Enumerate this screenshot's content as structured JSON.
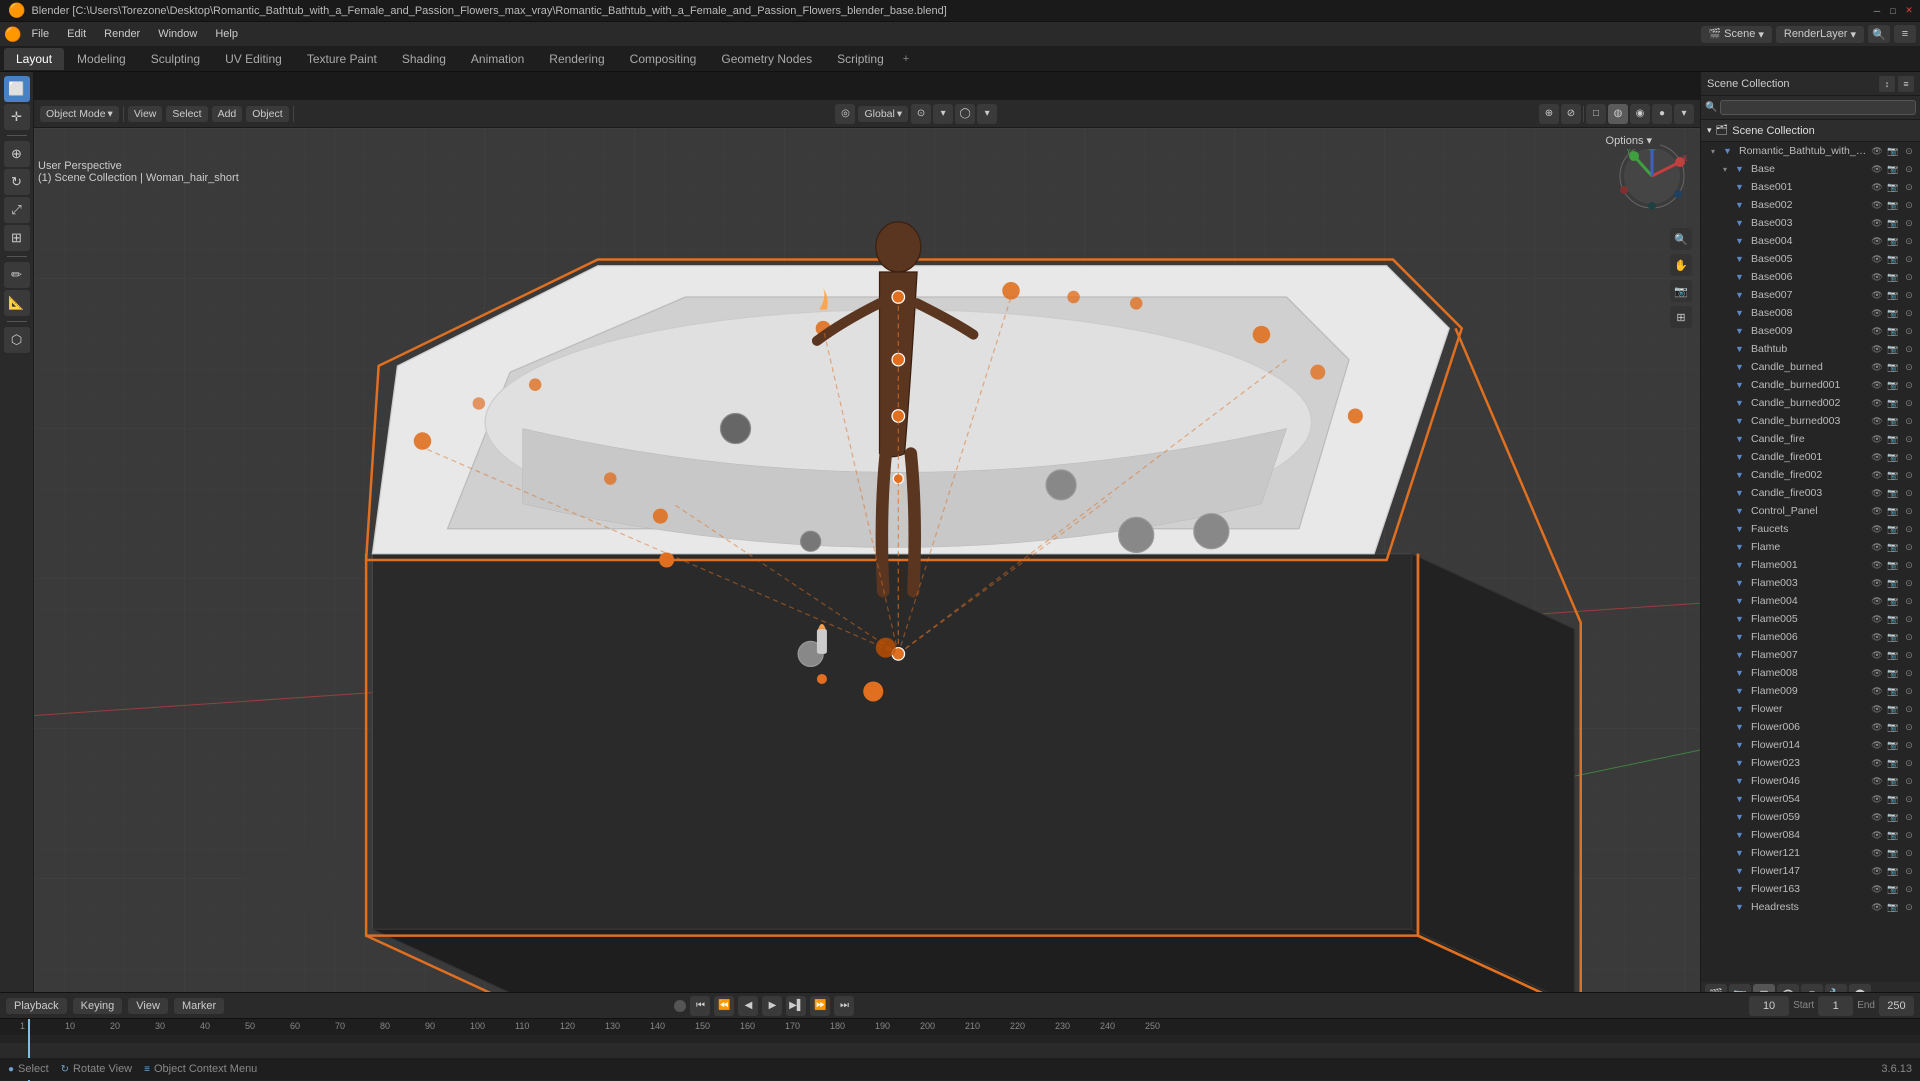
{
  "title": {
    "text": "Blender [C:\\Users\\Torezone\\Desktop\\Romantic_Bathtub_with_a_Female_and_Passion_Flowers_max_vray\\Romantic_Bathtub_with_a_Female_and_Passion_Flowers_blender_base.blend]",
    "window_controls": [
      "minimize",
      "maximize",
      "close"
    ]
  },
  "menu": {
    "items": [
      "Blender",
      "File",
      "Edit",
      "Render",
      "Window",
      "Help"
    ]
  },
  "workspaces": {
    "tabs": [
      "Layout",
      "Modeling",
      "Sculpting",
      "UV Editing",
      "Texture Paint",
      "Shading",
      "Animation",
      "Rendering",
      "Compositing",
      "Geometry Nodes",
      "Scripting"
    ],
    "active": "Layout",
    "add_label": "+"
  },
  "header_toolbar": {
    "mode": "Object Mode",
    "dropdown_arrow": "▾",
    "view_label": "View",
    "select_label": "Select",
    "add_label": "Add",
    "object_label": "Object",
    "transform": "Global",
    "transform_arrow": "▾"
  },
  "viewport": {
    "mode_label": "User Perspective",
    "collection_label": "(1) Scene Collection | Woman_hair_short",
    "options_label": "Options",
    "options_arrow": "▾"
  },
  "left_toolbar": {
    "tools": [
      {
        "name": "select-box",
        "icon": "⬜"
      },
      {
        "name": "cursor",
        "icon": "✛"
      },
      {
        "name": "move",
        "icon": "⊕"
      },
      {
        "name": "rotate",
        "icon": "↻"
      },
      {
        "name": "scale",
        "icon": "⤢"
      },
      {
        "name": "transform",
        "icon": "⊞"
      },
      {
        "name": "annotate",
        "icon": "✏"
      },
      {
        "name": "measure",
        "icon": "📏"
      },
      {
        "name": "add-primitive",
        "icon": "⬡"
      }
    ]
  },
  "outliner": {
    "title": "Scene Collection",
    "items": [
      {
        "name": "Romantic_Bathtub_with_a_Female_and",
        "indent": 0,
        "has_arrow": true,
        "selected": false
      },
      {
        "name": "Base",
        "indent": 1,
        "has_arrow": true,
        "selected": false
      },
      {
        "name": "Base001",
        "indent": 1,
        "has_arrow": false,
        "selected": false
      },
      {
        "name": "Base002",
        "indent": 1,
        "has_arrow": false,
        "selected": false
      },
      {
        "name": "Base003",
        "indent": 1,
        "has_arrow": false,
        "selected": false
      },
      {
        "name": "Base004",
        "indent": 1,
        "has_arrow": false,
        "selected": false
      },
      {
        "name": "Base005",
        "indent": 1,
        "has_arrow": false,
        "selected": false
      },
      {
        "name": "Base006",
        "indent": 1,
        "has_arrow": false,
        "selected": false
      },
      {
        "name": "Base007",
        "indent": 1,
        "has_arrow": false,
        "selected": false
      },
      {
        "name": "Base008",
        "indent": 1,
        "has_arrow": false,
        "selected": false
      },
      {
        "name": "Base009",
        "indent": 1,
        "has_arrow": false,
        "selected": false
      },
      {
        "name": "Bathtub",
        "indent": 1,
        "has_arrow": false,
        "selected": false
      },
      {
        "name": "Candle_burned",
        "indent": 1,
        "has_arrow": false,
        "selected": false
      },
      {
        "name": "Candle_burned001",
        "indent": 1,
        "has_arrow": false,
        "selected": false
      },
      {
        "name": "Candle_burned002",
        "indent": 1,
        "has_arrow": false,
        "selected": false
      },
      {
        "name": "Candle_burned003",
        "indent": 1,
        "has_arrow": false,
        "selected": false
      },
      {
        "name": "Candle_fire",
        "indent": 1,
        "has_arrow": false,
        "selected": false
      },
      {
        "name": "Candle_fire001",
        "indent": 1,
        "has_arrow": false,
        "selected": false
      },
      {
        "name": "Candle_fire002",
        "indent": 1,
        "has_arrow": false,
        "selected": false
      },
      {
        "name": "Candle_fire003",
        "indent": 1,
        "has_arrow": false,
        "selected": false
      },
      {
        "name": "Control_Panel",
        "indent": 1,
        "has_arrow": false,
        "selected": false
      },
      {
        "name": "Faucets",
        "indent": 1,
        "has_arrow": false,
        "selected": false
      },
      {
        "name": "Flame",
        "indent": 1,
        "has_arrow": false,
        "selected": false
      },
      {
        "name": "Flame001",
        "indent": 1,
        "has_arrow": false,
        "selected": false
      },
      {
        "name": "Flame003",
        "indent": 1,
        "has_arrow": false,
        "selected": false
      },
      {
        "name": "Flame004",
        "indent": 1,
        "has_arrow": false,
        "selected": false
      },
      {
        "name": "Flame005",
        "indent": 1,
        "has_arrow": false,
        "selected": false
      },
      {
        "name": "Flame006",
        "indent": 1,
        "has_arrow": false,
        "selected": false
      },
      {
        "name": "Flame007",
        "indent": 1,
        "has_arrow": false,
        "selected": false
      },
      {
        "name": "Flame008",
        "indent": 1,
        "has_arrow": false,
        "selected": false
      },
      {
        "name": "Flame009",
        "indent": 1,
        "has_arrow": false,
        "selected": false
      },
      {
        "name": "Flower",
        "indent": 1,
        "has_arrow": false,
        "selected": false
      },
      {
        "name": "Flower006",
        "indent": 1,
        "has_arrow": false,
        "selected": false
      },
      {
        "name": "Flower014",
        "indent": 1,
        "has_arrow": false,
        "selected": false
      },
      {
        "name": "Flower023",
        "indent": 1,
        "has_arrow": false,
        "selected": false
      },
      {
        "name": "Flower046",
        "indent": 1,
        "has_arrow": false,
        "selected": false
      },
      {
        "name": "Flower054",
        "indent": 1,
        "has_arrow": false,
        "selected": false
      },
      {
        "name": "Flower059",
        "indent": 1,
        "has_arrow": false,
        "selected": false
      },
      {
        "name": "Flower084",
        "indent": 1,
        "has_arrow": false,
        "selected": false
      },
      {
        "name": "Flower121",
        "indent": 1,
        "has_arrow": false,
        "selected": false
      },
      {
        "name": "Flower147",
        "indent": 1,
        "has_arrow": false,
        "selected": false
      },
      {
        "name": "Flower163",
        "indent": 1,
        "has_arrow": false,
        "selected": false
      },
      {
        "name": "Headrests",
        "indent": 1,
        "has_arrow": false,
        "selected": false
      }
    ]
  },
  "render_layer": {
    "scene_label": "Scene",
    "layer_label": "RenderLayer"
  },
  "timeline": {
    "playback_label": "Playback",
    "keying_label": "Keying",
    "view_label": "View",
    "marker_label": "Marker",
    "current_frame": "10",
    "start_label": "Start",
    "start_frame": "1",
    "end_label": "End",
    "end_frame": "250",
    "frame_numbers": [
      1,
      10,
      20,
      30,
      40,
      50,
      60,
      70,
      80,
      90,
      100,
      110,
      120,
      130,
      140,
      150,
      160,
      170,
      180,
      190,
      200,
      210,
      220,
      230,
      240,
      250
    ]
  },
  "status_bar": {
    "select_label": "Select",
    "rotate_view_label": "Rotate View",
    "context_menu_label": "Object Context Menu",
    "version": "3.6.13"
  },
  "shading_buttons": [
    {
      "name": "wireframe",
      "icon": "□"
    },
    {
      "name": "solid",
      "icon": "◍"
    },
    {
      "name": "material",
      "icon": "◉"
    },
    {
      "name": "rendered",
      "icon": "●"
    }
  ],
  "colors": {
    "accent": "#4a7fc1",
    "bg_dark": "#1a1a1a",
    "bg_medium": "#2a2a2a",
    "bg_light": "#3a3a3a",
    "selection": "#e07020",
    "text": "#cccccc",
    "x_axis": "#c04040",
    "y_axis": "#40a040",
    "z_axis": "#4060c0"
  }
}
